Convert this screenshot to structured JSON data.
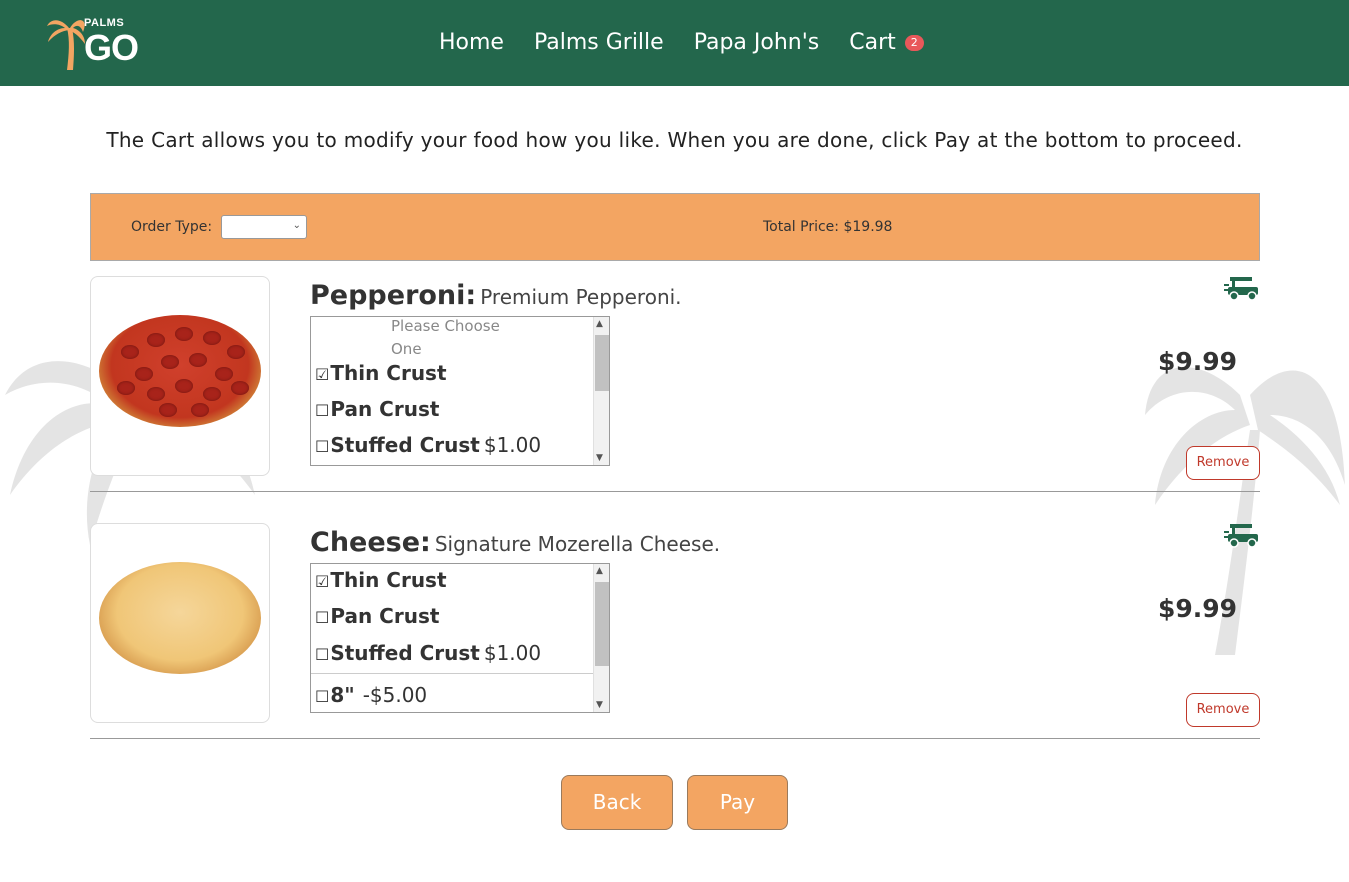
{
  "brand": {
    "logo_small": "PALMS",
    "logo_big": "GO",
    "header_color": "#23674c",
    "accent_color": "#f3a562"
  },
  "nav": {
    "home": "Home",
    "palms_grille": "Palms Grille",
    "papa_johns": "Papa John's",
    "cart": "Cart",
    "cart_count": "2"
  },
  "intro": "The Cart allows you to modify your food how you like. When you are done, click Pay at the bottom to proceed.",
  "order_bar": {
    "order_type_label": "Order Type:",
    "order_type_value": "",
    "total_price_label": "Total Price:",
    "total_price_value": "$19.98"
  },
  "items": [
    {
      "name": "Pepperoni:",
      "description": "Premium Pepperoni.",
      "price": "$9.99",
      "remove_label": "Remove",
      "options_placeholder": "Please Choose One",
      "options": [
        {
          "label": "Thin Crust",
          "price": "",
          "checked": "☑"
        },
        {
          "label": "Pan Crust",
          "price": "",
          "checked": "☐"
        },
        {
          "label": "Stuffed Crust",
          "price": "$1.00",
          "checked": "☐"
        }
      ]
    },
    {
      "name": "Cheese:",
      "description": "Signature Mozerella Cheese.",
      "price": "$9.99",
      "remove_label": "Remove",
      "options": [
        {
          "label": "Thin Crust",
          "price": "",
          "checked": "☑"
        },
        {
          "label": "Pan Crust",
          "price": "",
          "checked": "☐"
        },
        {
          "label": "Stuffed Crust",
          "price": "$1.00",
          "checked": "☐"
        },
        {
          "label": "8\"",
          "price": "-$5.00",
          "checked": "☐"
        }
      ]
    }
  ],
  "buttons": {
    "back": "Back",
    "pay": "Pay"
  }
}
